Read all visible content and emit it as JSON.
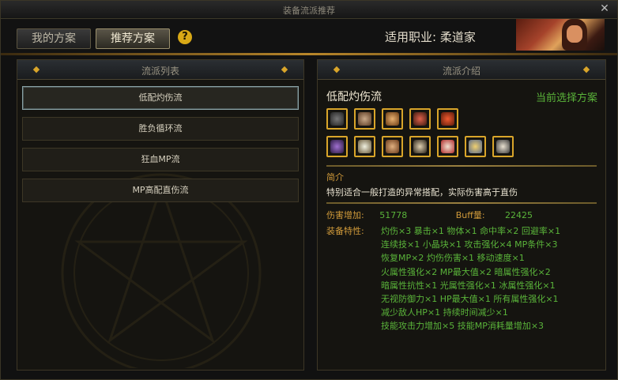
{
  "window": {
    "title": "装备流派推荐",
    "close_symbol": "✕"
  },
  "tabs": {
    "my_label": "我的方案",
    "recommended_label": "推荐方案",
    "help_symbol": "?"
  },
  "job": {
    "label": "适用职业:",
    "value": "柔道家"
  },
  "left_panel": {
    "title": "流派列表",
    "items": [
      {
        "label": "低配灼伤流",
        "selected": true
      },
      {
        "label": "胜负循环流",
        "selected": false
      },
      {
        "label": "狂血MP流",
        "selected": false
      },
      {
        "label": "MP高配直伤流",
        "selected": false
      }
    ]
  },
  "right_panel": {
    "title": "流派介绍",
    "style_name": "低配灼伤流",
    "current_plan_label": "当前选择方案",
    "icons_row1": [
      "dark-armor-icon",
      "gauntlet-icon",
      "fist-icon",
      "helmet-icon",
      "flame-shield-icon"
    ],
    "icons_row2": [
      "purple-armor-icon",
      "white-gem-icon",
      "tan-mask-icon",
      "dark-orb-icon",
      "red-gem-icon",
      "golden-gauntlet-icon",
      "jar-icon"
    ],
    "intro_label": "简介",
    "intro_text": "特别适合一般打造的异常搭配，实际伤害高于直伤",
    "damage_label": "伤害增加:",
    "damage_value": "51778",
    "buff_label": "Buff量:",
    "buff_value": "22425",
    "features_label": "装备特性:",
    "features": [
      "灼伤×3  暴击×1  物体×1  命中率×2  回避率×1",
      "连续技×1  小晶块×1  攻击强化×4  MP条件×3",
      "恢复MP×2  灼伤伤害×1  移动速度×1",
      "火属性强化×2  MP最大值×2  暗属性强化×2",
      "暗属性抗性×1  光属性强化×1  冰属性强化×1",
      "无视防御力×1  HP最大值×1  所有属性强化×1",
      "减少敌人HP×1  持续时间减少×1",
      "技能攻击力增加×5  技能MP消耗量增加×3"
    ]
  },
  "colors": {
    "accent_gold": "#d9a52a",
    "feature_green": "#5ab43a",
    "label_orange": "#d09a3a"
  }
}
